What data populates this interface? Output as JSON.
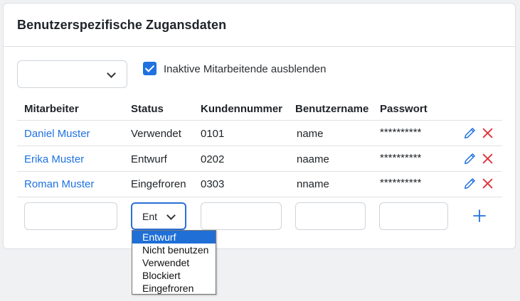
{
  "card": {
    "title": "Benutzerspezifische Zugansdaten"
  },
  "filter": {
    "selected_value": ""
  },
  "inactive_toggle": {
    "label": "Inaktive Mitarbeitende ausblenden",
    "checked": true
  },
  "table": {
    "headers": [
      "Mitarbeiter",
      "Status",
      "Kundennummer",
      "Benutzername",
      "Passwort"
    ],
    "rows": [
      {
        "employee": "Daniel Muster",
        "status": "Verwendet",
        "customer_number": "0101",
        "username": "name",
        "password": "**********"
      },
      {
        "employee": "Erika Muster",
        "status": "Entwurf",
        "customer_number": "0202",
        "username": "naame",
        "password": "**********"
      },
      {
        "employee": "Roman Muster",
        "status": "Eingefroren",
        "customer_number": "0303",
        "username": "nname",
        "password": "**********"
      }
    ]
  },
  "new_row": {
    "status_value": "Ent",
    "status_options": [
      "Entwurf",
      "Nicht benutzen",
      "Verwendet",
      "Blockiert",
      "Eingefroren"
    ],
    "selected_option": "Entwurf"
  },
  "colors": {
    "accent": "#1f72e0",
    "delete": "#e0343c",
    "border": "#ced4da"
  },
  "icons": {
    "edit": "pencil-icon",
    "delete": "close-icon",
    "add": "plus-icon",
    "dropdown": "chevron-down-icon",
    "checkbox": "checkmark-icon"
  }
}
